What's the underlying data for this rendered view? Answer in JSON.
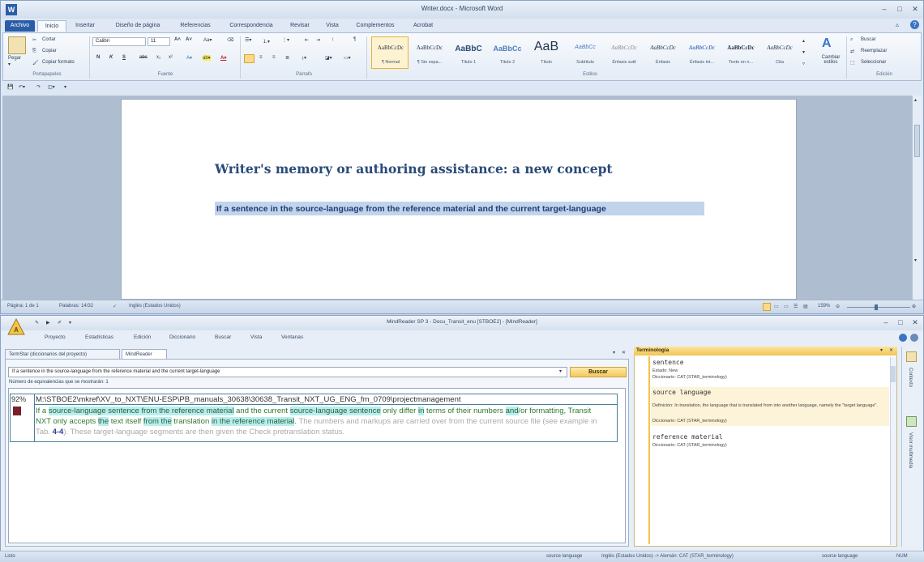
{
  "word": {
    "title": "Writer.docx - Microsoft Word",
    "tabs": [
      "Archivo",
      "Inicio",
      "Insertar",
      "Diseño de página",
      "Referencias",
      "Correspondencia",
      "Revisar",
      "Vista",
      "Complementos",
      "Acrobat"
    ],
    "clipboard": {
      "paste": "Pegar",
      "cut": "Cortar",
      "copy": "Copiar",
      "format_painter": "Copiar formato",
      "label": "Portapapeles"
    },
    "font": {
      "name": "Calibri",
      "size": "11",
      "label": "Fuente"
    },
    "paragraph_label": "Párrafo",
    "styles": [
      {
        "preview": "AaBbCcDc",
        "name": "¶ Normal"
      },
      {
        "preview": "AaBbCcDc",
        "name": "¶ Sin espa..."
      },
      {
        "preview": "AaBbC",
        "name": "Título 1"
      },
      {
        "preview": "AaBbCc",
        "name": "Título 2"
      },
      {
        "preview": "AaB",
        "name": "Título"
      },
      {
        "preview": "AaBbCc",
        "name": "Subtítulo"
      },
      {
        "preview": "AaBbCcDc",
        "name": "Énfasis sutil"
      },
      {
        "preview": "AaBbCcDc",
        "name": "Énfasis"
      },
      {
        "preview": "AaBbCcDc",
        "name": "Énfasis int..."
      },
      {
        "preview": "AaBbCcDc",
        "name": "Texto en n..."
      },
      {
        "preview": "AaBbCcDc",
        "name": "Cita"
      }
    ],
    "styles_label": "Estilos",
    "change_styles": "Cambiar estilos",
    "editing": {
      "find": "Buscar",
      "replace": "Reemplazar",
      "select": "Seleccionar",
      "label": "Edición"
    },
    "doc_title": "Writer's memory or authoring assistance: a new concept",
    "doc_text": "If a sentence in the source-language from the reference material and the current target-language",
    "status": {
      "page": "Página: 1 de 1",
      "words": "Palabras: 14/32",
      "language": "Inglés (Estados Unidos)",
      "zoom": "159%"
    }
  },
  "mr": {
    "title": "MindReader SP 3 - Docu_Transit_enu [STBOE2] - [MindReader]",
    "menu": [
      "Proyecto",
      "Estadísticas",
      "Edición",
      "Diccionario",
      "Buscar",
      "Vista",
      "Ventanas"
    ],
    "tabs": [
      "TermStar (diccionarios del proyecto)",
      "MindReader"
    ],
    "search_value": "If a sentence in the source-language from the reference material and the current target-language",
    "search_button": "Buscar",
    "count_label": "Número de equivalencias que se mostrarán: 1",
    "result": {
      "percent": "92%",
      "path": "M:\\STBOE2\\mkref\\XV_to_NXT\\ENU-ESP\\PB_manuals_30638\\30638_Transit_NXT_UG_ENG_fm_0709\\projectmanagement",
      "t1": "If a",
      "h1": "source-language sentence from the reference material",
      "t2": " and the current ",
      "h2": "source-language sentence",
      "t3": " only differ ",
      "h3": "in",
      "t4": " terms of their numbers ",
      "h4": "and",
      "t5": "/or formatting, Transit NXT only accepts ",
      "h5": "the",
      "t6": " text itself ",
      "h6": "from the",
      "t7": " translation ",
      "h7": "in the reference material",
      "t8": ". ",
      "g1": "The numbers and markups are carried over from the current source file (see example in Tab. ",
      "b1": "4-4",
      "g2": "). These target-language segments are then given the Check pretranslation status."
    },
    "terminology": {
      "header": "Terminología",
      "entries": [
        {
          "name": "sentence",
          "status": "Estado: New",
          "dict": "Diccionario: CAT (STAR_terminology)"
        },
        {
          "name": "source language",
          "definition": "Definición: In translation, the language that is translated from into another language, namely the \"target language\".",
          "dict": "Diccionario: CAT (STAR_terminology)"
        },
        {
          "name": "reference material",
          "dict": "Diccionario: CAT (STAR_terminology)"
        }
      ]
    },
    "side": {
      "contexts": "Contexto",
      "multimedia": "Visor multimedia"
    },
    "status": {
      "ready": "Listo",
      "term1": "source language",
      "lang": "Inglés (Estados Unidos) -> Alemán: CAT (STAR_terminology)",
      "term2": "source language",
      "mode": "NUM"
    }
  },
  "colors": {
    "accent": "#2b5ca8",
    "highlight": "#b8eef0",
    "term_header": "#f3c453",
    "selection": "#c2d3ec"
  }
}
